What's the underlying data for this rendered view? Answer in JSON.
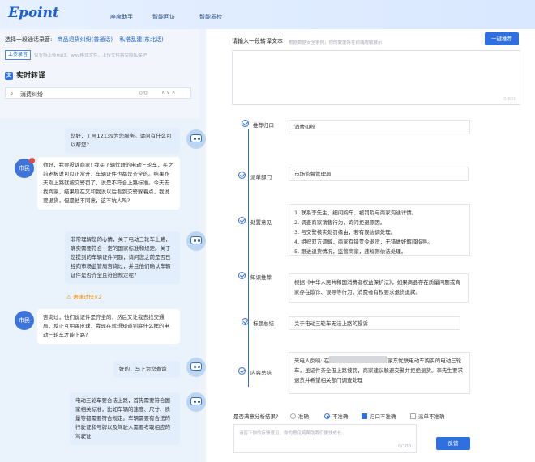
{
  "header": {
    "logo": "Epoint",
    "nav": [
      "座席助手",
      "智能回访",
      "智能质检"
    ]
  },
  "left": {
    "select_label": "选择一段通话录音:",
    "samples": [
      "商品退货纠纷(普通话)",
      "私搭乱建(东北话)"
    ],
    "upload_button": "上传录音",
    "upload_hint": "仅支持上传mp3、wav格式文件，上传文件将受隐私保护",
    "realtime_title": "实时转译",
    "search": {
      "value": "消费纠纷",
      "count": "0/0"
    },
    "messages": [
      {
        "role": "agent",
        "text": "您好，工号12139为您服务。请问有什么可以帮您?"
      },
      {
        "role": "user",
        "label": "市民",
        "text": "你好，我要投诉商家! 我买了辆忧联的电动三轮车，买之前老板说可以正常开，车辆证件也都是齐全的。结果昨天刚上路就被交警罚了，说是不符合上路标准。今天去找商家，结果现在又和我说以后看到交警躲着点，我说要退货，但是他不同意，这不坑人吗?"
      },
      {
        "role": "agent",
        "text": "非常理解您的心情，关于电动三轮车上路，确实需要符合一定的国家标准和规定。关于您提到的车辆证件问题，请问您之前是否已经向市场监管局咨询过，并且他们确认车辆证件是否齐全且符合规定呢?",
        "warn": "语速过快×2"
      },
      {
        "role": "user",
        "label": "市民",
        "text": "咨询过，他们说证件是齐全的，然后又让我去找交通局，反正互相踢皮球，我现在就想知道到底什么样的电动三轮车才能上路?"
      },
      {
        "role": "agent",
        "text": "好的，马上为您查询"
      },
      {
        "role": "agent",
        "text": "电动三轮车要合法上路，首先需要符合国家相关标准，比如车辆的速度、尺寸、质量等都需要符合规定。车辆需要有合法的行驶证和号牌以及驾驶人需要考取相应的驾驶证"
      }
    ]
  },
  "right": {
    "input_label": "请输入一段转译文本",
    "input_hint": "根据数据安全条例，你的数据将在前端脱敏展示",
    "recommend_button": "一键推荐",
    "textarea_count": "0/800",
    "steps": [
      {
        "label": "推荐归口",
        "value": "消费纠纷"
      },
      {
        "label": "派单部门",
        "value": "市场监督管理局"
      },
      {
        "label": "处置意见",
        "lines": [
          "1. 联系李先生，细问购车、被罚及与商家沟通详情。",
          "2. 调查商家销售行为，询问拒退原因。",
          "3. 与交警核实处罚缘由，若有误协调处理。",
          "4. 组织双方调解，商家有错责令退货，无错做好解释指导。",
          "5. 跟进退货情况，监管商家，违规则依法处理。"
        ]
      },
      {
        "label": "知识推荐",
        "value": "根据《中华人民共和国消费者权益保护法》，如果商品存在质量问题或商家存在欺诈、误导等行为，消费者有权要求退货退款。"
      },
      {
        "label": "标题总结",
        "value": "关于电动三轮车无法上路的投诉"
      },
      {
        "label": "内容总结",
        "pre": "来电人反映: 在",
        "post": "家东忧联电动车购买的电动三轮车，虽证件齐全但上路被罚，商家建议躲避交警并拒绝退货。李先生要求退货并希望相关部门调查处理"
      }
    ],
    "question": "是否满意分析结果?",
    "options": [
      "准确",
      "不准确",
      "归口不准确",
      "派单不准确"
    ],
    "feedback_placeholder": "请留下你的反馈意见，你的意见将帮助我们更快成长。",
    "feedback_count": "0/100",
    "feedback_button": "反馈"
  }
}
